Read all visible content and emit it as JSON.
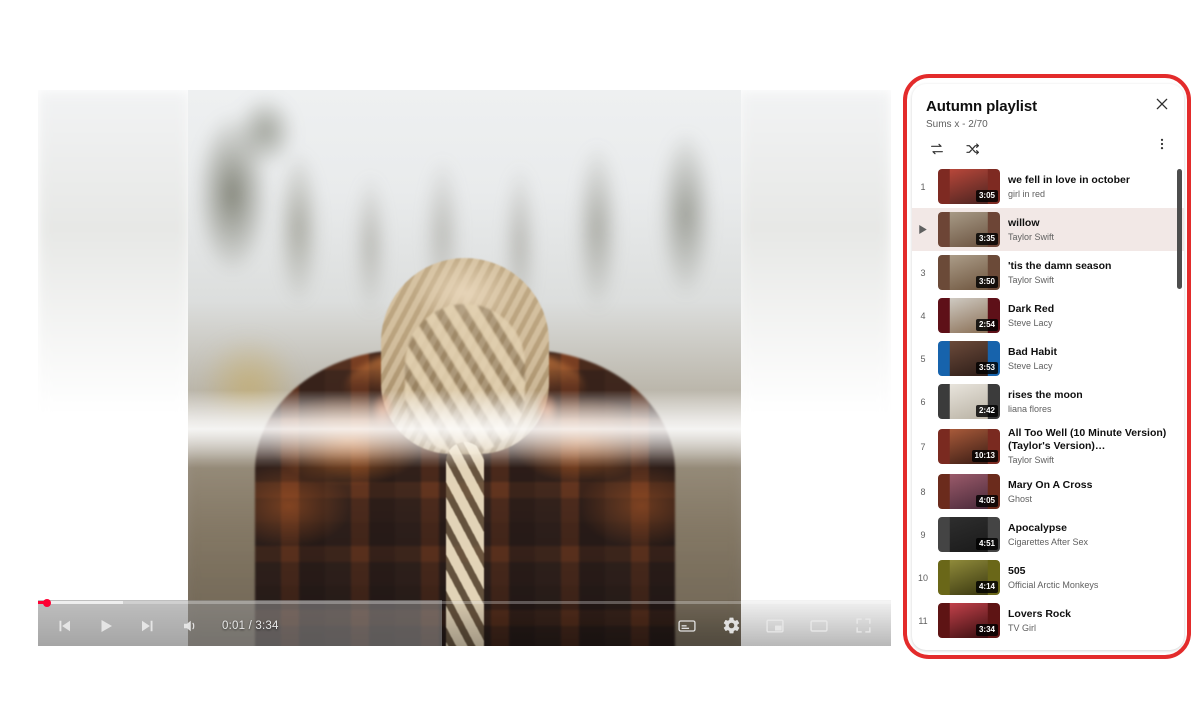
{
  "player": {
    "current_time": "0:01",
    "total_time": "3:34",
    "time_display": "0:01 / 3:34",
    "progress_percent": 1.1,
    "buffered_percent": 10,
    "controls": {
      "previous": "previous-video",
      "play": "play",
      "next": "next-video",
      "mute": "mute",
      "subtitles": "subtitles",
      "settings": "settings",
      "miniplayer": "miniplayer",
      "theater": "theater-mode",
      "fullscreen": "fullscreen"
    }
  },
  "playlist": {
    "title": "Autumn playlist",
    "subtitle": "Sums x - 2/70",
    "close_label": "Close",
    "more_label": "More options",
    "loop_label": "Loop playlist",
    "shuffle_label": "Shuffle playlist",
    "items": [
      {
        "index": "1",
        "title": "we fell in love in october",
        "artist": "girl in red",
        "duration": "3:05",
        "active": false,
        "thumb_bg": "#7e2a22",
        "art_a": "#b8473a",
        "art_b": "#4a2320"
      },
      {
        "index": "2",
        "title": "willow",
        "artist": "Taylor Swift",
        "duration": "3:35",
        "active": true,
        "thumb_bg": "#6d4536",
        "art_a": "#a79a86",
        "art_b": "#6b5340"
      },
      {
        "index": "3",
        "title": "'tis the damn season",
        "artist": "Taylor Swift",
        "duration": "3:50",
        "active": false,
        "thumb_bg": "#6b4a38",
        "art_a": "#ab9c88",
        "art_b": "#6f563f"
      },
      {
        "index": "4",
        "title": "Dark Red",
        "artist": "Steve Lacy",
        "duration": "2:54",
        "active": false,
        "thumb_bg": "#5e1018",
        "art_a": "#cfcac2",
        "art_b": "#8a6f55"
      },
      {
        "index": "5",
        "title": "Bad Habit",
        "artist": "Steve Lacy",
        "duration": "3:53",
        "active": false,
        "thumb_bg": "#1763ac",
        "art_a": "#6b4a3a",
        "art_b": "#2d1d18"
      },
      {
        "index": "6",
        "title": "rises the moon",
        "artist": "liana flores",
        "duration": "2:42",
        "active": false,
        "thumb_bg": "#3b3b3b",
        "art_a": "#e8e4dc",
        "art_b": "#b9b2a4"
      },
      {
        "index": "7",
        "title": "All Too Well (10 Minute Version) (Taylor's Version)…",
        "artist": "Taylor Swift",
        "duration": "10:13",
        "active": false,
        "thumb_bg": "#7a2a20",
        "art_a": "#a85a3a",
        "art_b": "#3a1c14"
      },
      {
        "index": "8",
        "title": "Mary On A Cross",
        "artist": "Ghost",
        "duration": "4:05",
        "active": false,
        "thumb_bg": "#6b2b1c",
        "art_a": "#9a5a6a",
        "art_b": "#4a2a3a"
      },
      {
        "index": "9",
        "title": "Apocalypse",
        "artist": "Cigarettes After Sex",
        "duration": "4:51",
        "active": false,
        "thumb_bg": "#444444",
        "art_a": "#2e2e2e",
        "art_b": "#1a1a1a"
      },
      {
        "index": "10",
        "title": "505",
        "artist": "Official Arctic Monkeys",
        "duration": "4:14",
        "active": false,
        "thumb_bg": "#6a6718",
        "art_a": "#8f8a3a",
        "art_b": "#3a3810"
      },
      {
        "index": "11",
        "title": "Lovers Rock",
        "artist": "TV Girl",
        "duration": "3:34",
        "active": false,
        "thumb_bg": "#5e1414",
        "art_a": "#c2414a",
        "art_b": "#3a0e10"
      }
    ]
  },
  "colors": {
    "annotation": "#e32b2b",
    "accent": "#ff0033",
    "active_row": "#f2e8e6",
    "text_primary": "#0f0f0f",
    "text_secondary": "#606060"
  }
}
